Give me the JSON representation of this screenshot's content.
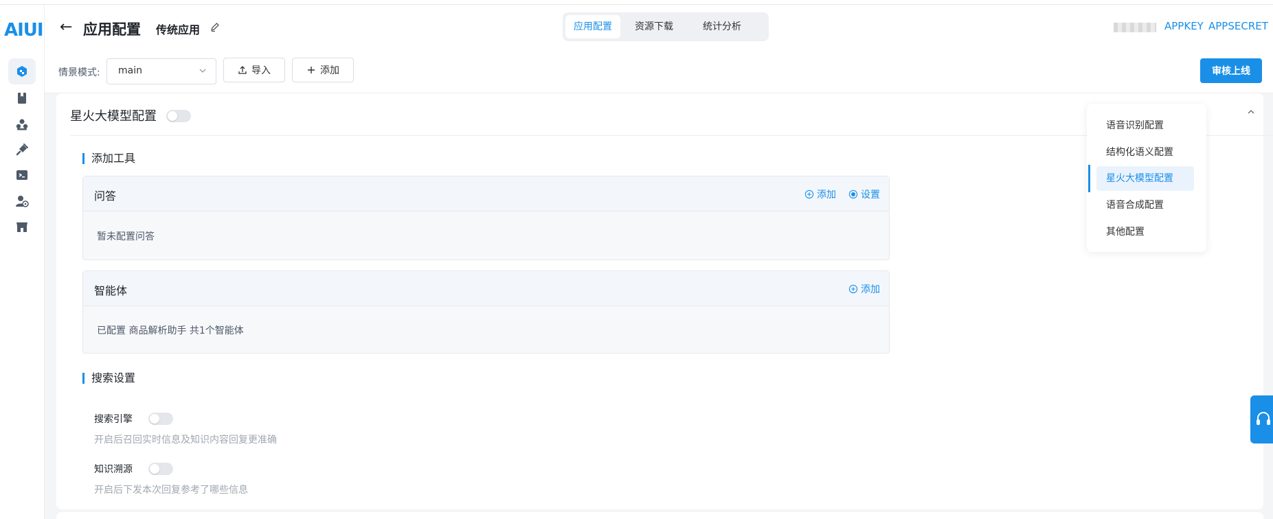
{
  "logo": "AIUI",
  "rail": {
    "items": [
      {
        "icon": "app-cube-icon",
        "active": true
      },
      {
        "icon": "bookmark-book-icon"
      },
      {
        "icon": "cluster-nodes-icon"
      },
      {
        "icon": "plug-icon"
      },
      {
        "icon": "terminal-icon"
      },
      {
        "icon": "user-settings-icon"
      },
      {
        "icon": "store-icon"
      }
    ]
  },
  "header": {
    "back_icon": "arrow-left-icon",
    "title": "应用配置",
    "app_name": "传统应用",
    "tabs": [
      "应用配置",
      "资源下载",
      "统计分析"
    ],
    "active_tab": 0,
    "appkey_label": "APPKEY",
    "appsecret_label": "APPSECRET"
  },
  "toolbar": {
    "scene_label": "情景模式:",
    "scene_value": "main",
    "import_label": "导入",
    "add_label": "添加",
    "publish_label": "审核上线"
  },
  "card": {
    "title": "星火大模型配置",
    "enabled": false,
    "sections": {
      "tools_title": "添加工具",
      "search_title": "搜索设置"
    },
    "qa": {
      "title": "问答",
      "add_label": "添加",
      "settings_label": "设置",
      "body": "暂未配置问答"
    },
    "agent": {
      "title": "智能体",
      "add_label": "添加",
      "body": "已配置 商品解析助手 共1个智能体"
    },
    "search_engine": {
      "label": "搜索引擎",
      "enabled": false,
      "desc": "开启后召回实时信息及知识内容回复更准确"
    },
    "knowledge_trace": {
      "label": "知识溯源",
      "enabled": false,
      "desc": "开启后下发本次回复参考了哪些信息"
    }
  },
  "anchor_nav": {
    "items": [
      "语音识别配置",
      "结构化语义配置",
      "星火大模型配置",
      "语音合成配置",
      "其他配置"
    ],
    "active": 2
  },
  "colors": {
    "accent": "#1a8fe8",
    "page_bg": "#f4f5f7",
    "panel_head": "#f3f7fc"
  }
}
